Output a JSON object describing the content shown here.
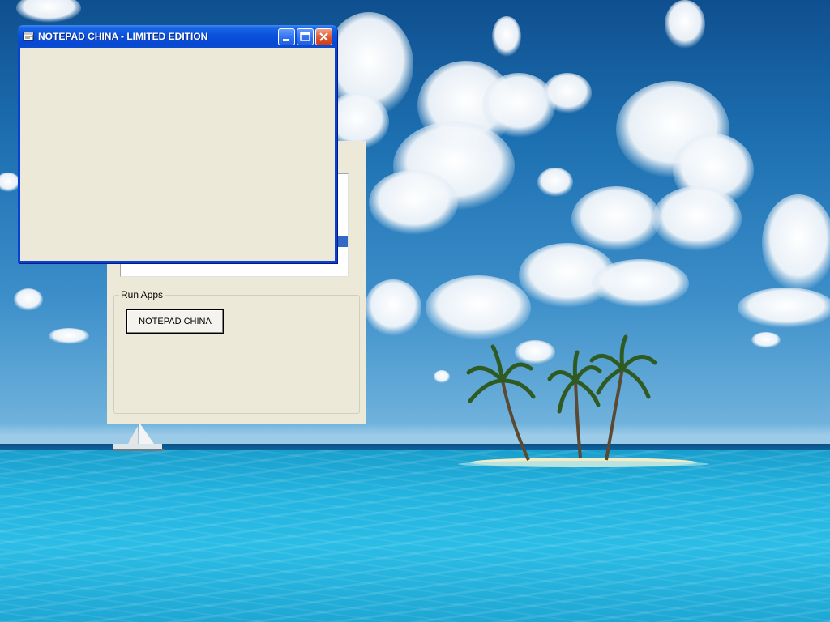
{
  "desktop": {
    "wallpaper": "tropical-island-beach"
  },
  "back_window": {
    "group_label": "Run Apps",
    "button_label": "NOTEPAD CHINA"
  },
  "notepad_window": {
    "title": "NOTEPAD CHINA - LIMITED EDITION",
    "icons": {
      "app": "notepad-app-icon",
      "minimize": "minimize-icon",
      "maximize": "maximize-icon",
      "close": "close-icon"
    }
  },
  "colors": {
    "xp_title_blue": "#0a52dc",
    "xp_window_face": "#ece9d8",
    "close_red": "#e0562d",
    "selection_blue": "#316ac5"
  }
}
